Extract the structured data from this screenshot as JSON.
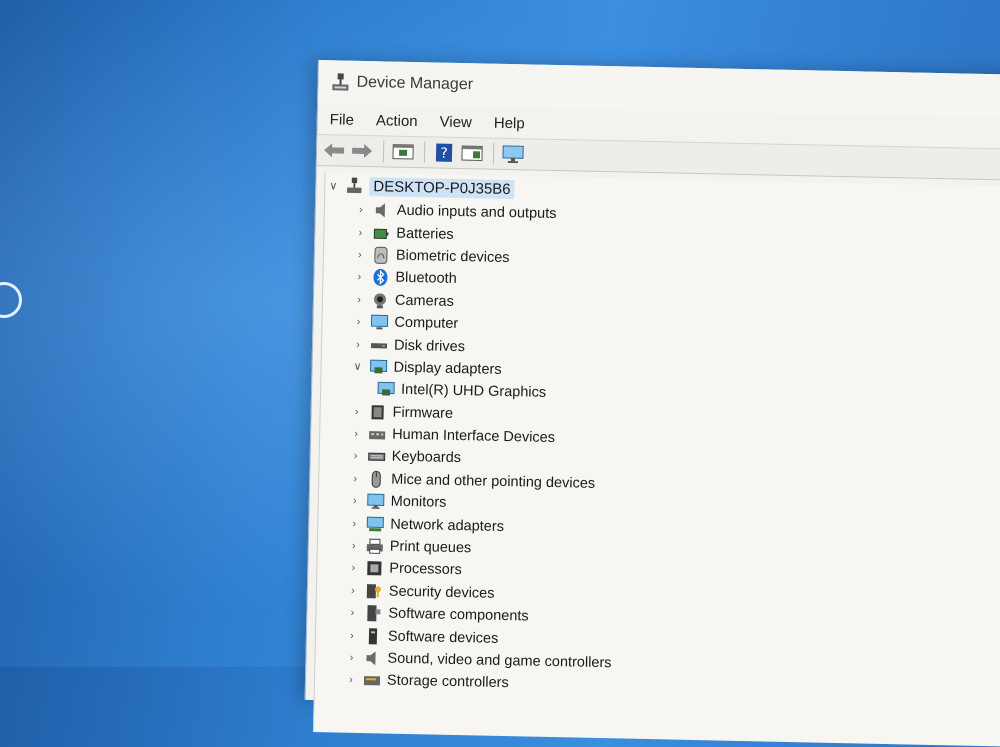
{
  "window": {
    "title": "Device Manager"
  },
  "menu": [
    "File",
    "Action",
    "View",
    "Help"
  ],
  "toolbar": {
    "buttons": [
      "back-icon",
      "forward-icon",
      "properties-icon",
      "help-icon",
      "show-hide-console-tree-icon",
      "monitor-icon"
    ]
  },
  "tree": {
    "root": {
      "label": "DESKTOP-P0J35B6",
      "expanded": true
    },
    "categories": [
      {
        "label": "Audio inputs and outputs",
        "icon": "speaker-icon",
        "expanded": false
      },
      {
        "label": "Batteries",
        "icon": "battery-icon",
        "expanded": false
      },
      {
        "label": "Biometric devices",
        "icon": "fingerprint-icon",
        "expanded": false
      },
      {
        "label": "Bluetooth",
        "icon": "bluetooth-icon",
        "expanded": false
      },
      {
        "label": "Cameras",
        "icon": "camera-icon",
        "expanded": false
      },
      {
        "label": "Computer",
        "icon": "computer-icon",
        "expanded": false
      },
      {
        "label": "Disk drives",
        "icon": "disk-icon",
        "expanded": false
      },
      {
        "label": "Display adapters",
        "icon": "display-adapter-icon",
        "expanded": true,
        "children": [
          {
            "label": "Intel(R) UHD Graphics",
            "icon": "display-adapter-icon"
          }
        ]
      },
      {
        "label": "Firmware",
        "icon": "chip-icon",
        "expanded": false
      },
      {
        "label": "Human Interface Devices",
        "icon": "hid-icon",
        "expanded": false
      },
      {
        "label": "Keyboards",
        "icon": "keyboard-icon",
        "expanded": false
      },
      {
        "label": "Mice and other pointing devices",
        "icon": "mouse-icon",
        "expanded": false
      },
      {
        "label": "Monitors",
        "icon": "monitor-icon",
        "expanded": false
      },
      {
        "label": "Network adapters",
        "icon": "network-icon",
        "expanded": false
      },
      {
        "label": "Print queues",
        "icon": "printer-icon",
        "expanded": false
      },
      {
        "label": "Processors",
        "icon": "processor-icon",
        "expanded": false
      },
      {
        "label": "Security devices",
        "icon": "security-icon",
        "expanded": false
      },
      {
        "label": "Software components",
        "icon": "software-component-icon",
        "expanded": false
      },
      {
        "label": "Software devices",
        "icon": "software-device-icon",
        "expanded": false
      },
      {
        "label": "Sound, video and game controllers",
        "icon": "speaker-icon",
        "expanded": false
      },
      {
        "label": "Storage controllers",
        "icon": "storage-icon",
        "expanded": false
      }
    ]
  }
}
